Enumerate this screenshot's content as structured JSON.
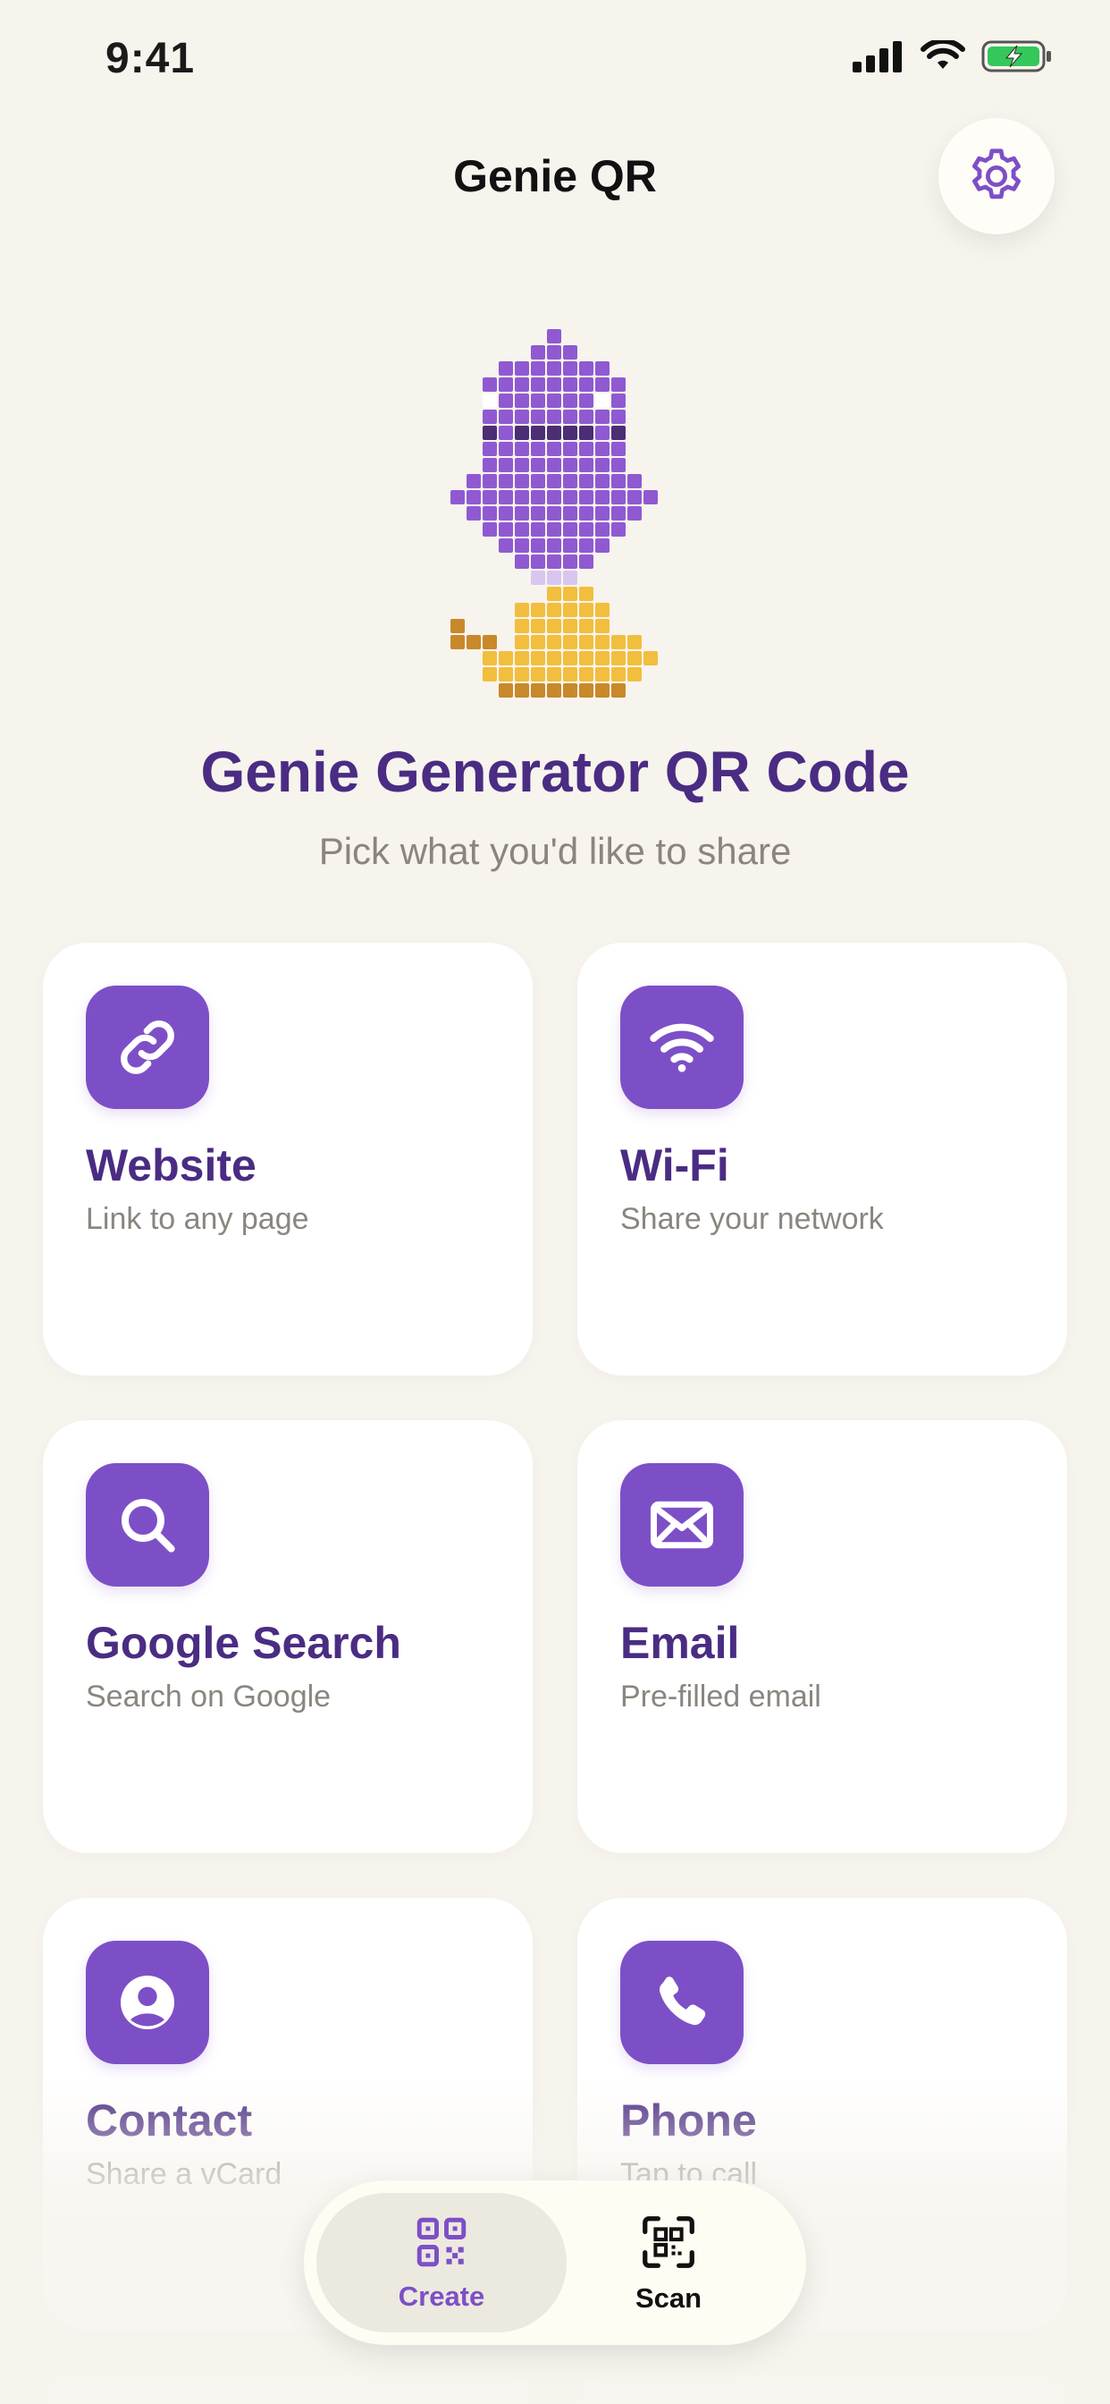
{
  "status_bar": {
    "time": "9:41"
  },
  "header": {
    "title": "Genie QR",
    "settings_icon": "gear-icon"
  },
  "hero": {
    "title": "Genie Generator QR Code",
    "subtitle": "Pick what you'd like to share"
  },
  "cards": [
    {
      "title": "Website",
      "subtitle": "Link to any page",
      "icon": "link-icon"
    },
    {
      "title": "Wi-Fi",
      "subtitle": "Share your network",
      "icon": "wifi-icon"
    },
    {
      "title": "Google Search",
      "subtitle": "Search on Google",
      "icon": "search-icon"
    },
    {
      "title": "Email",
      "subtitle": "Pre-filled email",
      "icon": "envelope-icon"
    },
    {
      "title": "Contact",
      "subtitle": "Share a vCard",
      "icon": "person-icon"
    },
    {
      "title": "Phone",
      "subtitle": "Tap to call",
      "icon": "phone-icon"
    }
  ],
  "tabbar": {
    "tabs": [
      {
        "label": "Create",
        "icon": "qr-code-icon",
        "active": true
      },
      {
        "label": "Scan",
        "icon": "qr-scan-icon",
        "active": false
      }
    ]
  },
  "colors": {
    "background": "#F7F4EE",
    "accent": "#7D4FC7",
    "title": "#4A2C83",
    "muted": "#8A857E",
    "mascot_body": "#8F5AD1",
    "mascot_lamp": "#F2BE3E"
  }
}
